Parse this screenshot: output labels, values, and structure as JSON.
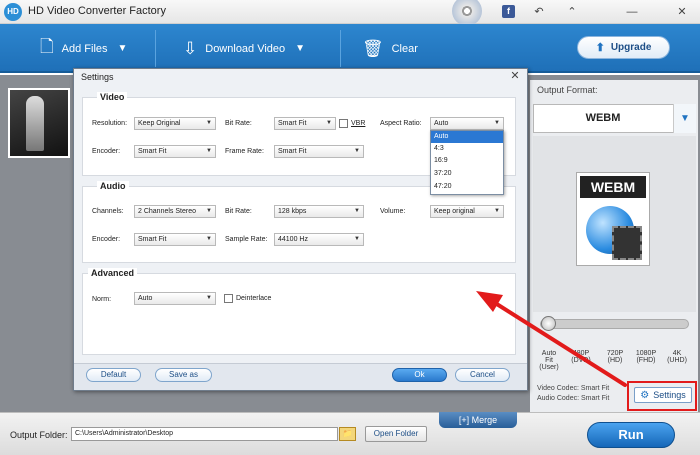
{
  "app": {
    "logo_text": "HD",
    "title": "HD Video Converter Factory"
  },
  "titlebar": {
    "facebook_glyph": "f",
    "undo_glyph": "↶",
    "share_glyph": "⌃",
    "minimize_glyph": "—",
    "close_glyph": "✕"
  },
  "toolbar": {
    "add_files": "Add Files",
    "download_video": "Download Video",
    "clear": "Clear",
    "upgrade": "Upgrade",
    "add_icon": "add-file-icon",
    "download_icon": "download-icon",
    "clear_icon": "trash-icon"
  },
  "right_panel": {
    "output_format_label": "Output Format:",
    "format_name": "WEBM",
    "preview_label": "WEBM",
    "quality_levels": [
      {
        "top": "Auto Fit",
        "bottom": "(User)"
      },
      {
        "top": "480P",
        "bottom": "(DVD)"
      },
      {
        "top": "720P",
        "bottom": "(HD)"
      },
      {
        "top": "1080P",
        "bottom": "(FHD)"
      },
      {
        "top": "4K",
        "bottom": "(UHD)"
      }
    ],
    "video_codec": "Video Codec: Smart Fit",
    "audio_codec": "Audio Codec: Smart Fit",
    "settings_button": "Settings"
  },
  "bottom": {
    "output_folder_label": "Output Folder:",
    "output_folder_value": "C:\\Users\\Administrator\\Desktop",
    "open_folder": "Open Folder",
    "merge": "Merge",
    "run": "Run"
  },
  "dialog": {
    "title": "Settings",
    "video": {
      "group_title": "Video",
      "resolution_label": "Resolution:",
      "resolution_value": "Keep Original",
      "bitrate_label": "Bit Rate:",
      "bitrate_value": "Smart Fit",
      "vbr_label": "VBR",
      "aspect_label": "Aspect Ratio:",
      "aspect_value": "Auto",
      "encoder_label": "Encoder:",
      "encoder_value": "Smart Fit",
      "framerate_label": "Frame Rate:",
      "framerate_value": "Smart Fit"
    },
    "aspect_options": [
      "Auto",
      "4:3",
      "16:9",
      "37:20",
      "47:20"
    ],
    "audio": {
      "group_title": "Audio",
      "channels_label": "Channels:",
      "channels_value": "2 Channels Stereo",
      "bitrate_label": "Bit Rate:",
      "bitrate_value": "128 kbps",
      "volume_label": "Volume:",
      "volume_value": "Keep original",
      "encoder_label": "Encoder:",
      "encoder_value": "Smart Fit",
      "samplerate_label": "Sample Rate:",
      "samplerate_value": "44100 Hz"
    },
    "advanced": {
      "group_title": "Advanced",
      "norm_label": "Norm:",
      "norm_value": "Auto",
      "deinterlace_label": "Deinterlace"
    },
    "buttons": {
      "default": "Default",
      "save_as": "Save as",
      "ok": "Ok",
      "cancel": "Cancel"
    }
  },
  "colors": {
    "toolbar": "#1f70b8",
    "annotation_red": "#e21b1b",
    "accent": "#2b78d3"
  }
}
